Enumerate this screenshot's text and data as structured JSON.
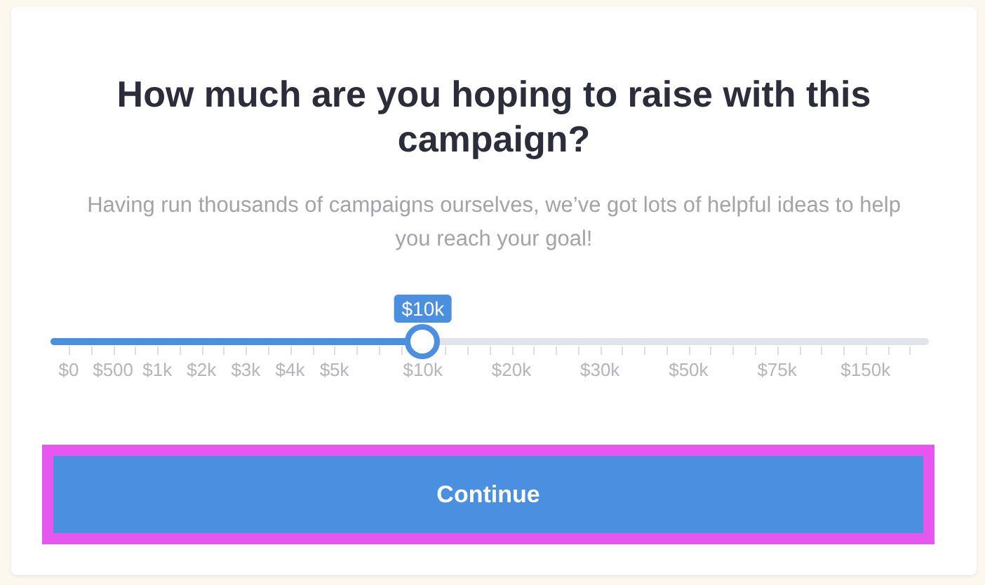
{
  "title": "How much are you hoping to raise with this campaign?",
  "subtitle": "Having run thousands of campaigns ourselves, we’ve got lots of helpful ideas to help you reach your goal!",
  "slider": {
    "level": 0.424,
    "reading": "$10k",
    "scale": [
      "$0",
      "$500",
      "$1k",
      "$2k",
      "$3k",
      "$4k",
      "$5k",
      "$10k",
      "$20k",
      "$30k",
      "$50k",
      "$75k",
      "$150k"
    ]
  },
  "button": {
    "label": "Continue"
  }
}
